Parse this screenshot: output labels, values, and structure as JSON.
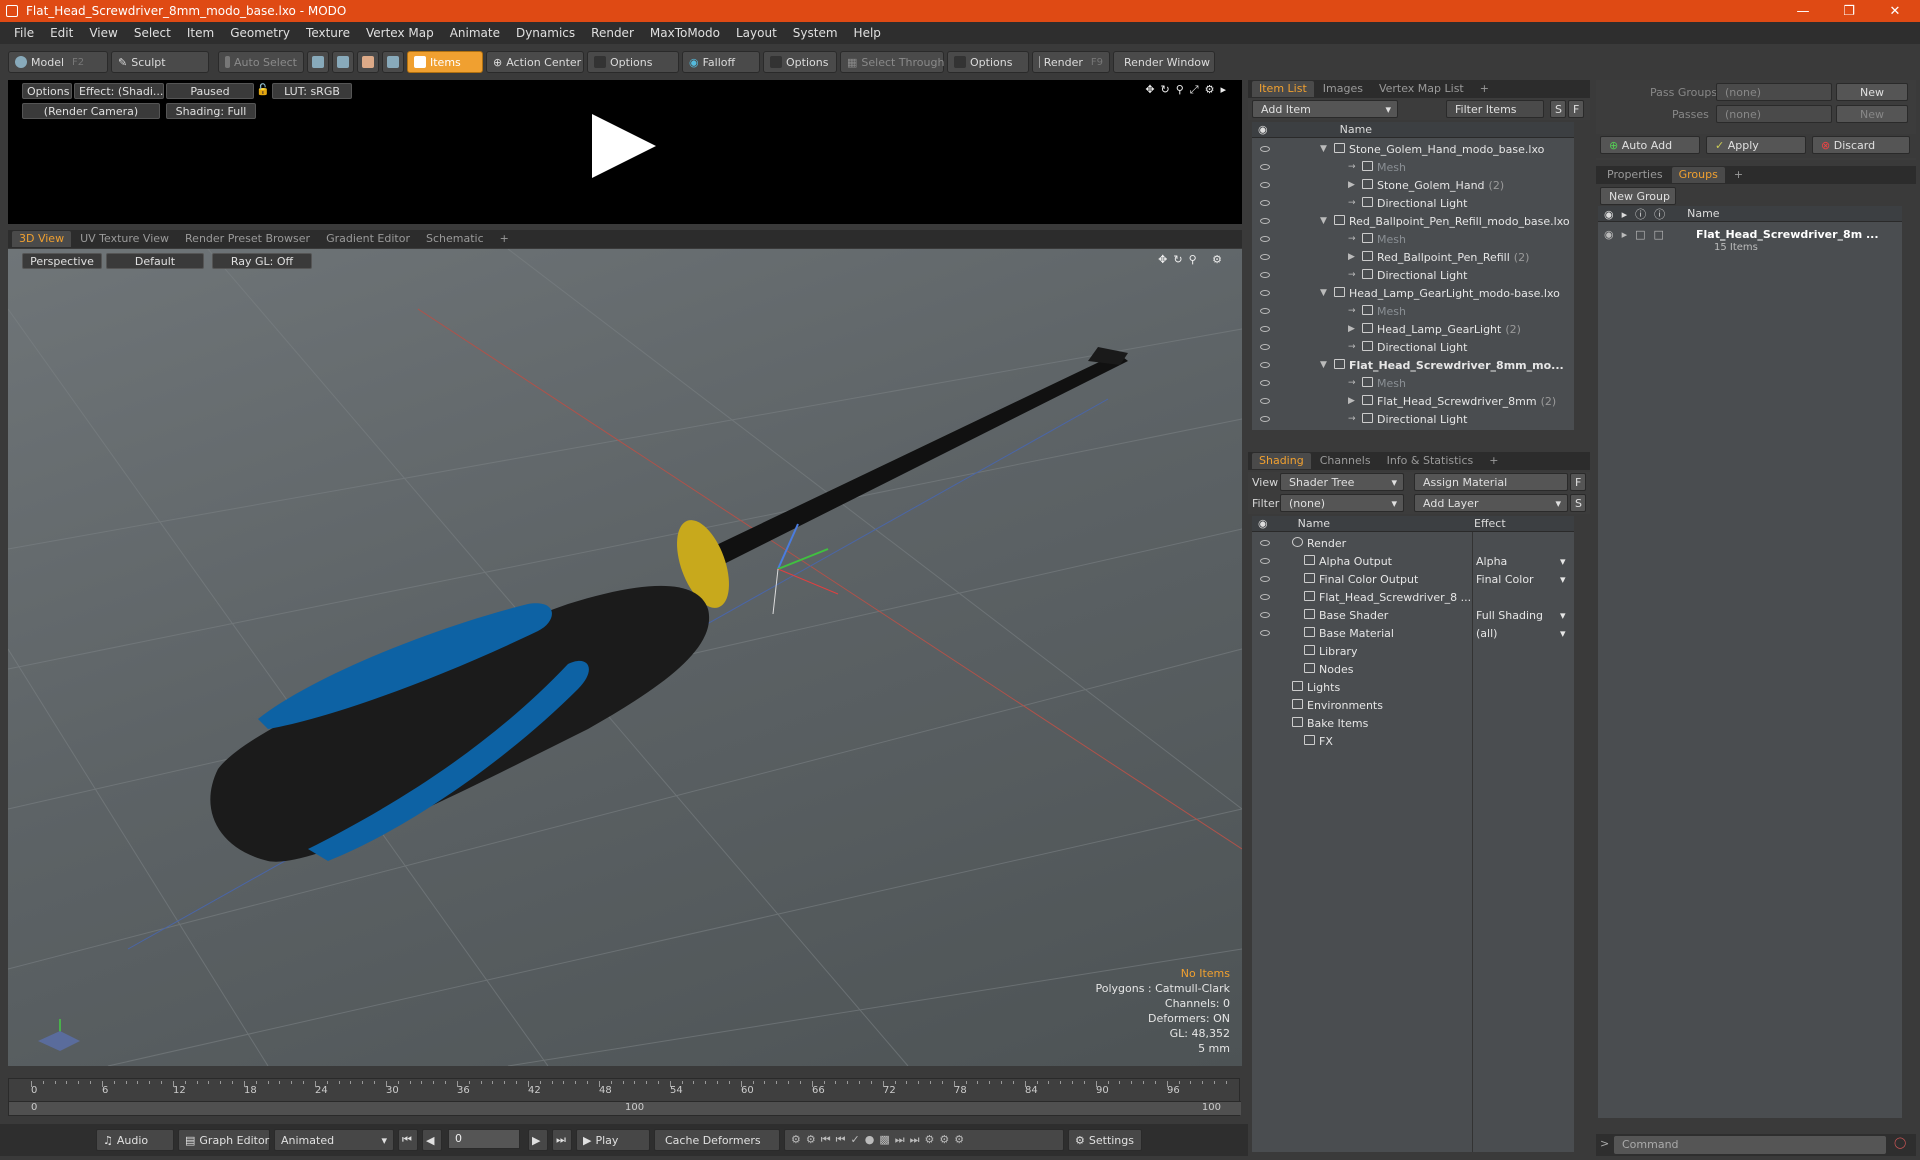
{
  "window": {
    "title": "Flat_Head_Screwdriver_8mm_modo_base.lxo - MODO"
  },
  "menu": [
    "File",
    "Edit",
    "View",
    "Select",
    "Item",
    "Geometry",
    "Texture",
    "Vertex Map",
    "Animate",
    "Dynamics",
    "Render",
    "MaxToModo",
    "Layout",
    "System",
    "Help"
  ],
  "toolbar": {
    "model": "Model",
    "model_key": "F2",
    "sculpt": "Sculpt",
    "auto_select": "Auto Select",
    "items": "Items",
    "action_center": "Action Center",
    "options1": "Options",
    "falloff": "Falloff",
    "options2": "Options",
    "select_through": "Select Through",
    "options3": "Options",
    "render": "Render",
    "render_key": "F9",
    "render_window": "Render Window"
  },
  "preview": {
    "options": "Options",
    "effect": "Effect: (Shadi...",
    "paused": "Paused",
    "lut": "LUT: sRGB",
    "camera": "(Render Camera)",
    "shading": "Shading: Full"
  },
  "viewport_tabs": [
    "3D View",
    "UV Texture View",
    "Render Preset Browser",
    "Gradient Editor",
    "Schematic",
    "+"
  ],
  "viewport": {
    "perspective": "Perspective",
    "default": "Default",
    "raygl": "Ray GL: Off",
    "info": {
      "no_items": "No Items",
      "polygons": "Polygons : Catmull-Clark",
      "channels": "Channels: 0",
      "deformers": "Deformers: ON",
      "gl": "GL: 48,352",
      "scale": "5 mm"
    }
  },
  "item_list": {
    "tabs": [
      "Item List",
      "Images",
      "Vertex Map List",
      "+"
    ],
    "add_item": "Add Item",
    "filter_items": "Filter Items",
    "s": "S",
    "f": "F",
    "col_name": "Name",
    "rows": [
      {
        "label": "Stone_Golem_Hand_modo_base.lxo",
        "indent": 0,
        "bold": false,
        "dim": false,
        "count": ""
      },
      {
        "label": "Mesh",
        "indent": 1,
        "bold": false,
        "dim": true,
        "count": ""
      },
      {
        "label": "Stone_Golem_Hand",
        "indent": 1,
        "bold": false,
        "dim": false,
        "count": "(2)"
      },
      {
        "label": "Directional Light",
        "indent": 1,
        "bold": false,
        "dim": false,
        "count": ""
      },
      {
        "label": "Red_Ballpoint_Pen_Refill_modo_base.lxo",
        "indent": 0,
        "bold": false,
        "dim": false,
        "count": ""
      },
      {
        "label": "Mesh",
        "indent": 1,
        "bold": false,
        "dim": true,
        "count": ""
      },
      {
        "label": "Red_Ballpoint_Pen_Refill",
        "indent": 1,
        "bold": false,
        "dim": false,
        "count": "(2)"
      },
      {
        "label": "Directional Light",
        "indent": 1,
        "bold": false,
        "dim": false,
        "count": ""
      },
      {
        "label": "Head_Lamp_GearLight_modo-base.lxo",
        "indent": 0,
        "bold": false,
        "dim": false,
        "count": ""
      },
      {
        "label": "Mesh",
        "indent": 1,
        "bold": false,
        "dim": true,
        "count": ""
      },
      {
        "label": "Head_Lamp_GearLight",
        "indent": 1,
        "bold": false,
        "dim": false,
        "count": "(2)"
      },
      {
        "label": "Directional Light",
        "indent": 1,
        "bold": false,
        "dim": false,
        "count": ""
      },
      {
        "label": "Flat_Head_Screwdriver_8mm_mo...",
        "indent": 0,
        "bold": true,
        "dim": false,
        "count": ""
      },
      {
        "label": "Mesh",
        "indent": 1,
        "bold": false,
        "dim": true,
        "count": ""
      },
      {
        "label": "Flat_Head_Screwdriver_8mm",
        "indent": 1,
        "bold": false,
        "dim": false,
        "count": "(2)"
      },
      {
        "label": "Directional Light",
        "indent": 1,
        "bold": false,
        "dim": false,
        "count": ""
      }
    ]
  },
  "shading": {
    "tabs": [
      "Shading",
      "Channels",
      "Info & Statistics",
      "+"
    ],
    "view_label": "View",
    "view_value": "Shader Tree",
    "assign_material": "Assign Material",
    "f": "F",
    "filter_label": "Filter",
    "filter_value": "(none)",
    "add_layer": "Add Layer",
    "s": "S",
    "col_name": "Name",
    "col_effect": "Effect",
    "rows": [
      {
        "label": "Render",
        "effect": "",
        "indent": 0
      },
      {
        "label": "Alpha Output",
        "effect": "Alpha",
        "indent": 1
      },
      {
        "label": "Final Color Output",
        "effect": "Final Color",
        "indent": 1
      },
      {
        "label": "Flat_Head_Screwdriver_8 ...",
        "effect": "",
        "indent": 1
      },
      {
        "label": "Base Shader",
        "effect": "Full Shading",
        "indent": 1
      },
      {
        "label": "Base Material",
        "effect": "(all)",
        "indent": 1
      },
      {
        "label": "Library",
        "effect": "",
        "indent": 1
      },
      {
        "label": "Nodes",
        "effect": "",
        "indent": 1
      },
      {
        "label": "Lights",
        "effect": "",
        "indent": 0
      },
      {
        "label": "Environments",
        "effect": "",
        "indent": 0
      },
      {
        "label": "Bake Items",
        "effect": "",
        "indent": 0
      },
      {
        "label": "FX",
        "effect": "",
        "indent": 1
      }
    ]
  },
  "groups_panel": {
    "pass_groups_label": "Pass Groups",
    "pass_groups_value": "(none)",
    "new1": "New",
    "passes_label": "Passes",
    "passes_value": "(none)",
    "new2": "New",
    "auto_add": "Auto Add",
    "apply": "Apply",
    "discard": "Discard",
    "tabs": [
      "Properties",
      "Groups",
      "+"
    ],
    "new_group": "New Group",
    "col_name": "Name",
    "group_name": "Flat_Head_Screwdriver_8m ...",
    "group_items": "15 Items"
  },
  "timeline": {
    "ticks": [
      "0",
      "6",
      "12",
      "18",
      "24",
      "30",
      "36",
      "42",
      "48",
      "54",
      "60",
      "66",
      "72",
      "78",
      "84",
      "90",
      "96"
    ],
    "range_start": "0",
    "range_mid": "100",
    "range_end": "100"
  },
  "bottom": {
    "audio": "Audio",
    "graph_editor": "Graph Editor",
    "animated": "Animated",
    "frame": "0",
    "play": "Play",
    "cache_deformers": "Cache Deformers",
    "settings": "Settings",
    "command": "Command"
  }
}
